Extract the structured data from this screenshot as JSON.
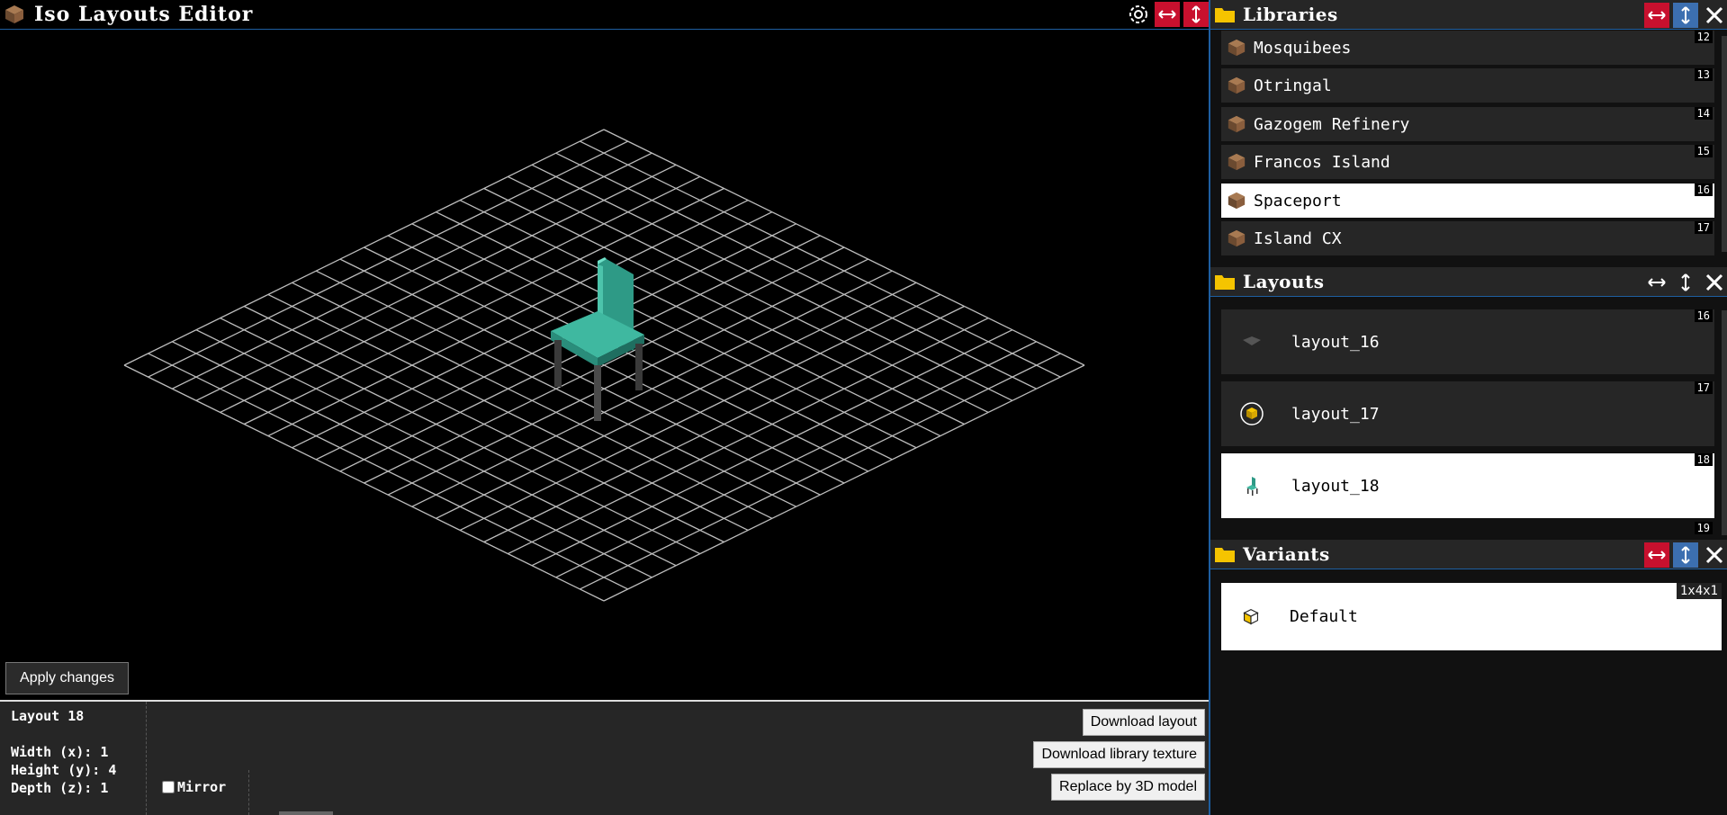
{
  "app": {
    "title": "Iso Layouts Editor"
  },
  "editor": {
    "apply_label": "Apply changes",
    "info": {
      "name": "Layout 18",
      "width": "Width (x): 1",
      "height": "Height (y): 4",
      "depth": "Depth (z): 1"
    },
    "mirror_label": "Mirror",
    "buttons": {
      "download_layout": "Download layout",
      "download_texture": "Download library texture",
      "replace_3d": "Replace by 3D model"
    }
  },
  "libraries": {
    "title": "Libraries",
    "items": [
      {
        "name": "Mosquibees",
        "index": "12"
      },
      {
        "name": "Otringal",
        "index": "13"
      },
      {
        "name": "Gazogem Refinery",
        "index": "14"
      },
      {
        "name": "Francos Island",
        "index": "15"
      },
      {
        "name": "Spaceport",
        "index": "16",
        "selected": true
      },
      {
        "name": "Island CX",
        "index": "17"
      }
    ]
  },
  "layouts": {
    "title": "Layouts",
    "items": [
      {
        "name": "layout_16",
        "index": "16"
      },
      {
        "name": "layout_17",
        "index": "17"
      },
      {
        "name": "layout_18",
        "index": "18",
        "selected": true
      }
    ],
    "next_index": "19"
  },
  "variants": {
    "title": "Variants",
    "items": [
      {
        "name": "Default",
        "dims": "1x4x1"
      }
    ]
  },
  "colors": {
    "accent": "#1e5ea0",
    "red": "#c8102e",
    "chair": "#3fb8a0",
    "grid": "#bdbdbd"
  }
}
